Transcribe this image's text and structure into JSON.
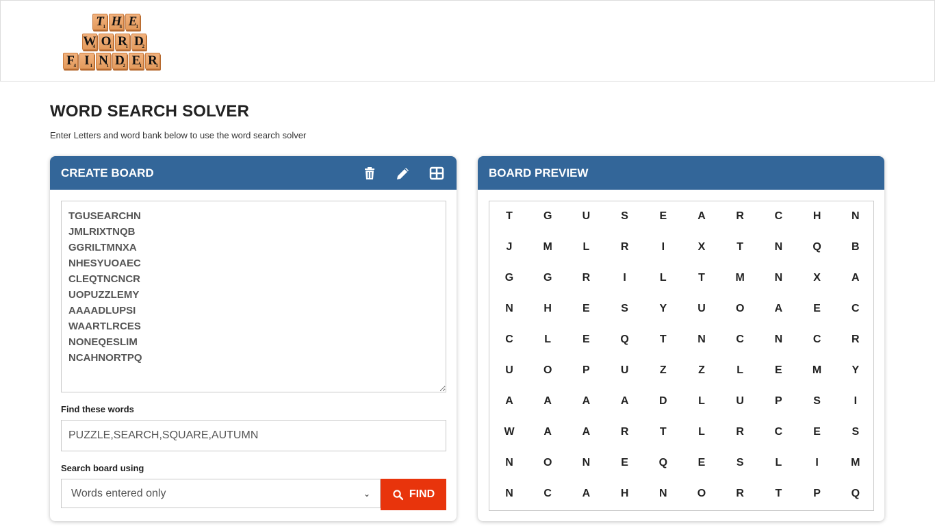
{
  "header": {
    "logo": {
      "alt": "The Word Finder",
      "rows": [
        [
          {
            "l": "T",
            "p": "1"
          },
          {
            "l": "H",
            "p": "4"
          },
          {
            "l": "E",
            "p": "1"
          }
        ],
        [
          {
            "l": "W",
            "p": "4"
          },
          {
            "l": "O",
            "p": "1"
          },
          {
            "l": "R",
            "p": "1"
          },
          {
            "l": "D",
            "p": "2"
          }
        ],
        [
          {
            "l": "F",
            "p": "4"
          },
          {
            "l": "I",
            "p": "1"
          },
          {
            "l": "N",
            "p": "1"
          },
          {
            "l": "D",
            "p": "2"
          },
          {
            "l": "E",
            "p": "1"
          },
          {
            "l": "R",
            "p": "1"
          }
        ]
      ]
    }
  },
  "page": {
    "title": "WORD SEARCH SOLVER",
    "subtitle": "Enter Letters and word bank below to use the word search solver"
  },
  "create_board": {
    "title": "CREATE BOARD",
    "icons": [
      "trash-icon",
      "pencil-icon",
      "grid-icon"
    ],
    "board_text": "TGUSEARCHN\nJMLRIXTNQB\nGGRILTMNXA\nNHESYUOAEC\nCLEQTNCNCR\nUOPUZZLEMY\nAAAADLUPSI\nWAARTLRCES\nNONEQESLIM\nNCAHNORTPQ",
    "find_words_label": "Find these words",
    "find_words_value": "PUZZLE,SEARCH,SQUARE,AUTUMN",
    "search_using_label": "Search board using",
    "search_using_selected": "Words entered only",
    "find_button_label": "FIND"
  },
  "board_preview": {
    "title": "BOARD PREVIEW",
    "rows": [
      "TGUSEARCHN",
      "JMLRIXTNQB",
      "GGRILTMNXA",
      "NHESYUOAEC",
      "CLEQTNCNCR",
      "UOPUZZLEMY",
      "AAAADLUPSI",
      "WAARTLRCES",
      "NONEQESLIM",
      "NCAHNORTPQ"
    ]
  },
  "colors": {
    "header_blue": "#336699",
    "find_button": "#e8340c"
  }
}
